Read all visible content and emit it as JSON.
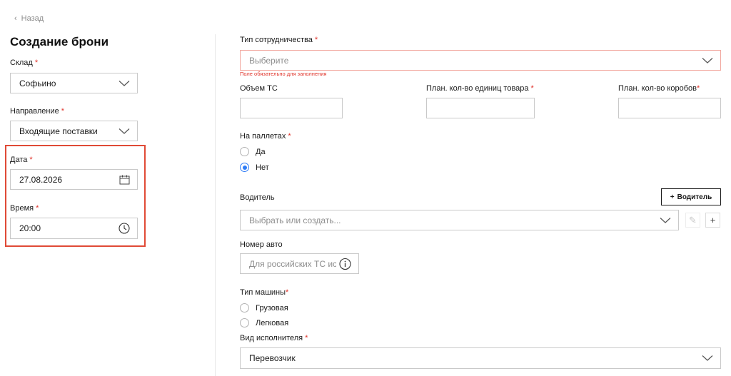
{
  "nav": {
    "back_label": "Назад"
  },
  "page": {
    "title": "Создание брони"
  },
  "left": {
    "warehouse": {
      "label": "Склад",
      "value": "Софьино"
    },
    "direction": {
      "label": "Направление",
      "value": "Входящие поставки"
    },
    "date": {
      "label": "Дата",
      "value": "27.08.2026"
    },
    "time": {
      "label": "Время",
      "value": "20:00"
    }
  },
  "right": {
    "cooperation_type": {
      "label": "Тип сотрудничества",
      "placeholder": "Выберите",
      "error": "Поле обязательно для заполнения"
    },
    "volume": {
      "label": "Объем ТС",
      "value": ""
    },
    "planned_units": {
      "label": "План. кол-во единиц товара",
      "value": ""
    },
    "planned_boxes": {
      "label": "План. кол-во коробов",
      "value": ""
    },
    "pallets": {
      "label": "На паллетах",
      "options": [
        "Да",
        "Нет"
      ],
      "selected": "Нет"
    },
    "driver": {
      "label": "Водитель",
      "add_button": "Водитель",
      "placeholder": "Выбрать или создать..."
    },
    "car_number": {
      "label": "Номер авто",
      "placeholder": "Для российских ТС исп"
    },
    "vehicle_type": {
      "label": "Тип машины",
      "options": [
        "Грузовая",
        "Легковая"
      ],
      "selected": ""
    },
    "executor_type": {
      "label": "Вид исполнителя",
      "value": "Перевозчик"
    }
  },
  "colors": {
    "required": "#e0342b",
    "error_border": "#f2a89f",
    "highlight": "#e04a36",
    "radio_active": "#2f7cf6"
  }
}
